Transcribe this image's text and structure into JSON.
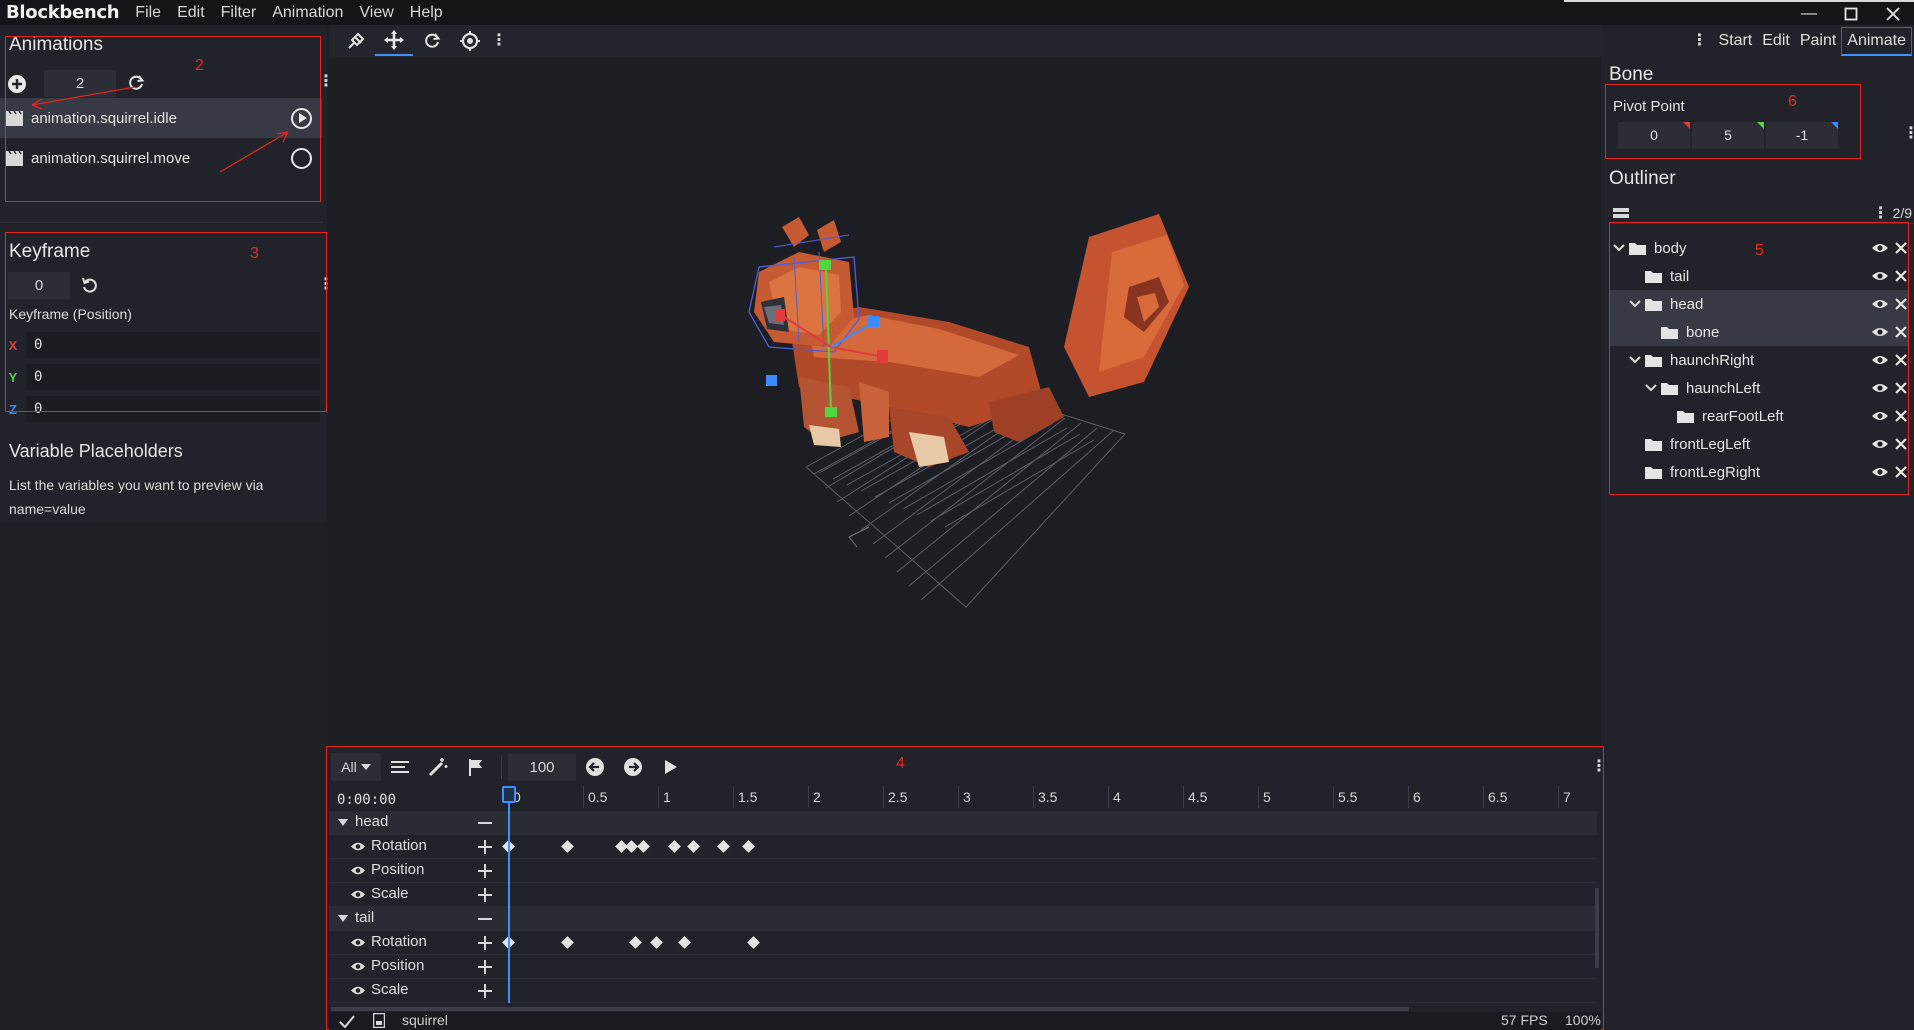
{
  "app": {
    "brand": "Blockbench"
  },
  "menu": [
    "File",
    "Edit",
    "Filter",
    "Animation",
    "View",
    "Help"
  ],
  "mode_tabs": [
    "Start",
    "Edit",
    "Paint",
    "Animate"
  ],
  "animations_panel": {
    "title": "Animations",
    "count": "2",
    "items": [
      {
        "label": "animation.squirrel.idle",
        "selected": true,
        "playing": true
      },
      {
        "label": "animation.squirrel.move",
        "selected": false,
        "playing": false
      }
    ]
  },
  "keyframe_panel": {
    "title": "Keyframe",
    "time": "0",
    "subtitle": "Keyframe (Position)",
    "x": "0",
    "y": "0",
    "z": "0",
    "x_label": "X",
    "y_label": "Y",
    "z_label": "Z"
  },
  "variable_panel": {
    "title": "Variable Placeholders",
    "description": "List the variables you want to preview via name=value"
  },
  "bone_panel": {
    "title": "Bone",
    "pivot_label": "Pivot Point",
    "pivot": [
      "0",
      "5",
      "-1"
    ]
  },
  "outliner": {
    "title": "Outliner",
    "count": "2/9",
    "items": [
      {
        "label": "body",
        "depth": 0,
        "expanded": true,
        "selected": false
      },
      {
        "label": "tail",
        "depth": 1,
        "expanded": false,
        "selected": false
      },
      {
        "label": "head",
        "depth": 1,
        "expanded": true,
        "selected": true
      },
      {
        "label": "bone",
        "depth": 2,
        "expanded": false,
        "selected": true
      },
      {
        "label": "haunchRight",
        "depth": 1,
        "expanded": true,
        "selected": false
      },
      {
        "label": "haunchLeft",
        "depth": 2,
        "expanded": true,
        "selected": false
      },
      {
        "label": "rearFootLeft",
        "depth": 3,
        "expanded": false,
        "selected": false
      },
      {
        "label": "frontLegLeft",
        "depth": 1,
        "expanded": false,
        "selected": false
      },
      {
        "label": "frontLegRight",
        "depth": 1,
        "expanded": false,
        "selected": false
      }
    ]
  },
  "timeline": {
    "filter": "All",
    "fps_field": "100",
    "timecode": "0:00:00",
    "ruler": [
      "0",
      "0.5",
      "1",
      "1.5",
      "2",
      "2.5",
      "3",
      "3.5",
      "4",
      "4.5",
      "5",
      "5.5",
      "6",
      "6.5",
      "7"
    ],
    "groups": [
      {
        "name": "head",
        "channels": [
          {
            "name": "Rotation",
            "keyframes": [
              0,
              0.48,
              0.92,
              1.0,
              1.1,
              1.35,
              1.5,
              1.75,
              1.95
            ]
          },
          {
            "name": "Position",
            "keyframes": []
          },
          {
            "name": "Scale",
            "keyframes": []
          }
        ]
      },
      {
        "name": "tail",
        "channels": [
          {
            "name": "Rotation",
            "keyframes": [
              0,
              0.48,
              1.03,
              1.2,
              1.43,
              1.99
            ]
          },
          {
            "name": "Position",
            "keyframes": []
          },
          {
            "name": "Scale",
            "keyframes": []
          }
        ]
      }
    ]
  },
  "status": {
    "project": "squirrel",
    "fps": "57 FPS",
    "zoom": "100%"
  },
  "annotations": [
    "2",
    "3",
    "4",
    "5",
    "6"
  ],
  "colors": {
    "accent": "#3e90ff",
    "annotation": "#e3261f",
    "x_axis": "#e33b3b",
    "y_axis": "#4fd641",
    "z_axis": "#3b8bff"
  }
}
